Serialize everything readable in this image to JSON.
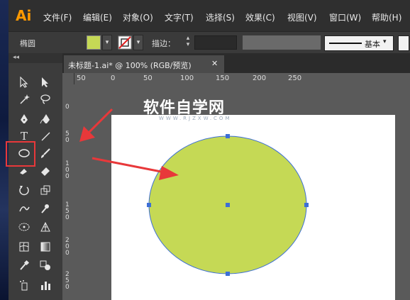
{
  "app": {
    "logo": "Ai"
  },
  "menu": [
    "文件(F)",
    "编辑(E)",
    "对象(O)",
    "文字(T)",
    "选择(S)",
    "效果(C)",
    "视图(V)",
    "窗口(W)",
    "帮助(H)"
  ],
  "control_bar": {
    "tool_name": "椭圆",
    "fill_color": "#c5d955",
    "stroke_label": "描边：",
    "stroke_preset": "基本"
  },
  "document_tab": {
    "title": "未标题-1.ai* @ 100% (RGB/预览)",
    "close": "✕"
  },
  "ruler_h": [
    "50",
    "0",
    "50",
    "100",
    "150",
    "200",
    "250"
  ],
  "ruler_v": [
    "0",
    "50",
    "100",
    "150",
    "200",
    "250"
  ],
  "watermark": {
    "title": "软件自学网",
    "subtitle": "WWW.RJZXW.COM"
  },
  "shape": {
    "fill": "#c5d955",
    "stroke": "#3d6fd6"
  },
  "annotation_color": "#e8383a"
}
